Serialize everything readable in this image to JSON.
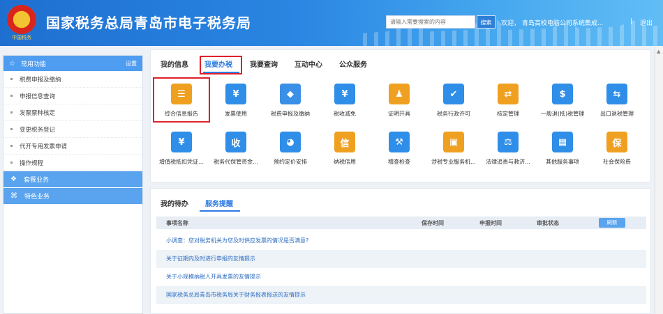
{
  "header": {
    "emblem_text": "中国税务",
    "title": "国家税务总局青岛市电子税务局",
    "search_placeholder": "请输入需要搜索的内容",
    "search_label": "搜索",
    "welcome": "欢迎，  青岛高校电脑公司系统集成...",
    "separator": "|",
    "logout_label": "退出"
  },
  "sidebar": {
    "head_title": "常用功能",
    "settings_label": "设置",
    "items": [
      {
        "label": "税费申报及缴纳"
      },
      {
        "label": "申报信息查询"
      },
      {
        "label": "发票票种核定"
      },
      {
        "label": "变更税务登记"
      },
      {
        "label": "代开专用发票申请"
      },
      {
        "label": "操作规程"
      }
    ],
    "groups": [
      {
        "label": "套餐业务",
        "icon": "layers-icon"
      },
      {
        "label": "特色业务",
        "icon": "grid-icon"
      }
    ]
  },
  "main": {
    "tabs": [
      {
        "label": "我的信息"
      },
      {
        "label": "我要办税"
      },
      {
        "label": "我要查询"
      },
      {
        "label": "互动中心"
      },
      {
        "label": "公众服务"
      }
    ],
    "tiles": [
      {
        "label": "综合信息报告",
        "icon": "report-icon",
        "color": "#f0a020",
        "glyph": "☰"
      },
      {
        "label": "发票使用",
        "icon": "invoice-icon",
        "color": "#2f8ee8",
        "glyph": "¥"
      },
      {
        "label": "税费申报及缴纳",
        "icon": "declare-icon",
        "color": "#3a8fe6",
        "glyph": "◆"
      },
      {
        "label": "税收减免",
        "icon": "reduction-icon",
        "color": "#2f8ee8",
        "glyph": "¥"
      },
      {
        "label": "证明开具",
        "icon": "certificate-icon",
        "color": "#f0a020",
        "glyph": "♟"
      },
      {
        "label": "税务行政许可",
        "icon": "permit-icon",
        "color": "#2f8ee8",
        "glyph": "✔"
      },
      {
        "label": "核定管理",
        "icon": "approval-icon",
        "color": "#f0a020",
        "glyph": "⇄"
      },
      {
        "label": "一般退(抵)税管理",
        "icon": "refund-icon",
        "color": "#2f8ee8",
        "glyph": "$"
      },
      {
        "label": "出口退税管理",
        "icon": "export-refund-icon",
        "color": "#2f8ee8",
        "glyph": "⇆"
      },
      {
        "label": "增值税抵扣凭证...",
        "icon": "vat-voucher-icon",
        "color": "#2f8ee8",
        "glyph": "¥"
      },
      {
        "label": "税务代保管资金...",
        "icon": "custody-icon",
        "color": "#2f8ee8",
        "glyph": "收"
      },
      {
        "label": "预约定价安排",
        "icon": "pricing-icon",
        "color": "#2f8ee8",
        "glyph": "◕"
      },
      {
        "label": "纳税信用",
        "icon": "credit-icon",
        "color": "#f0a020",
        "glyph": "信"
      },
      {
        "label": "稽查检查",
        "icon": "inspection-icon",
        "color": "#2f8ee8",
        "glyph": "⚒"
      },
      {
        "label": "涉税专业服务机...",
        "icon": "agency-icon",
        "color": "#f0a020",
        "glyph": "▣"
      },
      {
        "label": "法律追责与救济...",
        "icon": "law-icon",
        "color": "#2f8ee8",
        "glyph": "⚖"
      },
      {
        "label": "其他服务事项",
        "icon": "other-services-icon",
        "color": "#2f8ee8",
        "glyph": "▦"
      },
      {
        "label": "社会保险费",
        "icon": "insurance-icon",
        "color": "#f0a020",
        "glyph": "保"
      }
    ]
  },
  "todo": {
    "tabs": [
      {
        "label": "我的待办"
      },
      {
        "label": "服务提醒"
      }
    ],
    "columns": {
      "name": "事项名称",
      "save_time": "保存时间",
      "declare_time": "申报时间",
      "status": "审批状态",
      "refresh": "刷新"
    },
    "rows": [
      {
        "text": "小调查：您对税务机关为您及时供应发票的情况是否满意?"
      },
      {
        "text": "关于征期内及时进行申报的友情提示"
      },
      {
        "text": "关于小规模纳税人开具发票的友情提示"
      },
      {
        "text": "国家税务总局青岛市税务局关于财务报表报送的友情提示"
      }
    ]
  }
}
